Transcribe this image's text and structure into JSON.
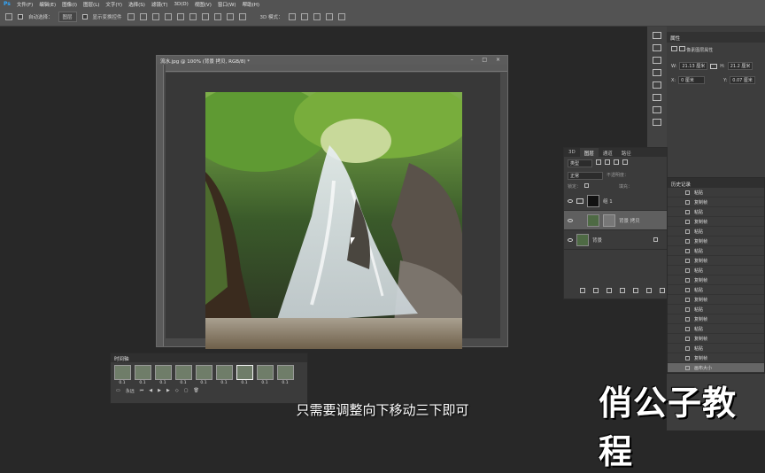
{
  "menubar": {
    "logo": "Ps",
    "items": [
      "文件(F)",
      "编辑(E)",
      "图像(I)",
      "图层(L)",
      "文字(Y)",
      "选择(S)",
      "滤镜(T)",
      "3D(D)",
      "视图(V)",
      "窗口(W)",
      "帮助(H)"
    ]
  },
  "options": {
    "auto_select_label": "自动选择：",
    "auto_select_value": "图层",
    "show_transform_label": "显示变换控件",
    "mode_3d_label": "3D 模式："
  },
  "document": {
    "title": "流水.jpg @ 100% (背景 拷贝, RGB/8) *",
    "window_buttons": "– □ ×"
  },
  "properties": {
    "title": "属性",
    "subtitle": "像素图层属性",
    "w_label": "W:",
    "w_value": "21.13 厘米",
    "h_label": "H:",
    "h_value": "21.2 厘米",
    "x_label": "X:",
    "x_value": "0 厘米",
    "y_label": "Y:",
    "y_value": "0.07 厘米"
  },
  "layers_panel": {
    "tabs": [
      "3D",
      "图层",
      "通道",
      "路径"
    ],
    "active_tab": "图层",
    "kind_filter": "类型",
    "blend_mode": "正常",
    "opacity_label": "不透明度：",
    "lock_label": "锁定：",
    "fill_label": "填充：",
    "layers": [
      {
        "name": "组 1",
        "type": "group"
      },
      {
        "name": "背景 拷贝",
        "type": "pixel",
        "selected": true
      },
      {
        "name": "背景",
        "type": "background"
      }
    ]
  },
  "history_panel": {
    "title": "历史记录",
    "items": [
      "粘贴",
      "复制帧",
      "粘贴",
      "复制帧",
      "粘贴",
      "复制帧",
      "粘贴",
      "复制帧",
      "粘贴",
      "复制帧",
      "粘贴",
      "复制帧",
      "粘贴",
      "复制帧",
      "粘贴",
      "复制帧",
      "粘贴",
      "复制帧",
      "画布大小"
    ],
    "selected_index": 18
  },
  "timeline_panel": {
    "title": "时间轴",
    "frames": [
      {
        "delay": "0.1"
      },
      {
        "delay": "0.1"
      },
      {
        "delay": "0.1"
      },
      {
        "delay": "0.1"
      },
      {
        "delay": "0.1"
      },
      {
        "delay": "0.1"
      },
      {
        "delay": "0.1",
        "selected": true
      },
      {
        "delay": "0.1"
      },
      {
        "delay": "0.1"
      },
      {
        "delay": "0.1"
      }
    ],
    "loop_label": "永远"
  },
  "overlay": {
    "subtitle": "只需要调整向下移动三下即可",
    "watermark": "俏公子教程"
  },
  "colors": {
    "workspace": "#282828",
    "panel": "#3b3b3b",
    "menubar": "#535353",
    "accent": "#31a8ff"
  }
}
